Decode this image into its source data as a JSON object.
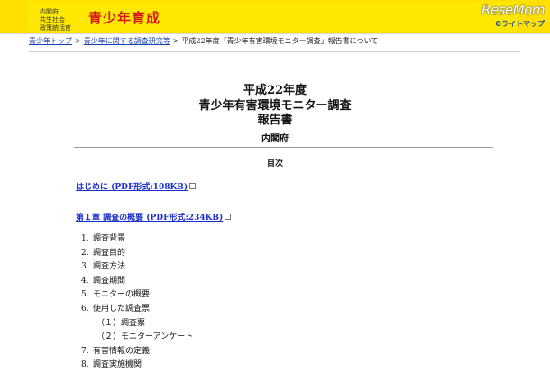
{
  "header": {
    "org_line1": "内閣府",
    "org_line2": "共生社会",
    "org_line3": "政策統括官",
    "site_title": "青少年育成",
    "logo_main": "ReseMom",
    "logo_sub_icon": "G",
    "logo_sub": "ライトマップ",
    "colors": {
      "band": "#ffe000",
      "title": "#d01818",
      "link": "#1a2fcc"
    }
  },
  "breadcrumb": {
    "items": [
      "青少年トップ",
      "青少年に関する調査研究等"
    ],
    "separator": ">",
    "current": "平成22年度「青少年有害環境モニター調査」報告書について"
  },
  "report": {
    "title_line1": "平成22年度",
    "title_line2": "青少年有害環境モニター調査",
    "title_line3": "報告書",
    "author": "内閣府"
  },
  "toc": {
    "heading": "目次",
    "links": [
      {
        "label": "はじめに (PDF形式:108KB)"
      },
      {
        "label": "第１章 調査の概要 (PDF形式:234KB)"
      }
    ],
    "items": [
      {
        "num": "1.",
        "text": "調査背景"
      },
      {
        "num": "2.",
        "text": "調査目的"
      },
      {
        "num": "3.",
        "text": "調査方法"
      },
      {
        "num": "4.",
        "text": "調査期間"
      },
      {
        "num": "5.",
        "text": "モニターの概要"
      },
      {
        "num": "6.",
        "text": "使用した調査票"
      },
      {
        "num": "",
        "text": "（１）調査票",
        "sub": true
      },
      {
        "num": "",
        "text": "（２）モニターアンケート",
        "sub": true
      },
      {
        "num": "7.",
        "text": "有害情報の定義"
      },
      {
        "num": "8.",
        "text": "調査実施機関"
      }
    ]
  }
}
